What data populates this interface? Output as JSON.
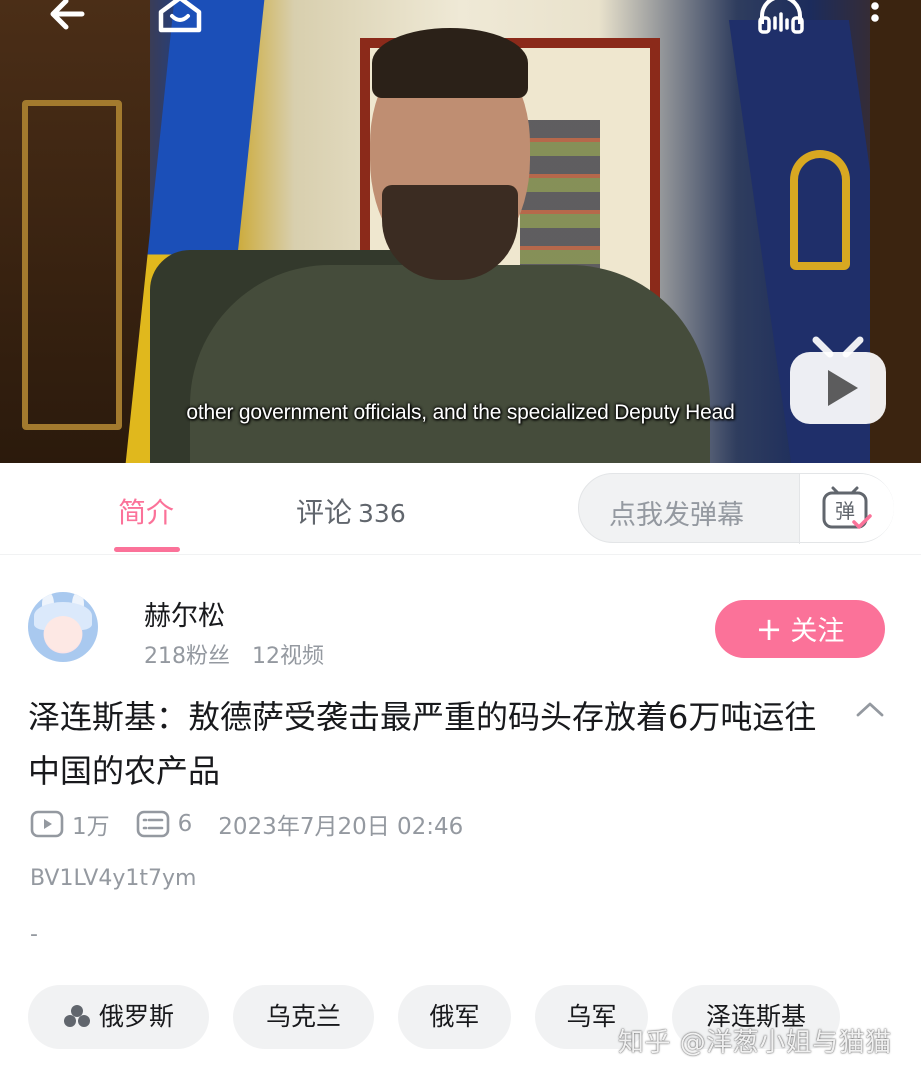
{
  "video": {
    "subtitle": "other government officials, and the specialized Deputy Head"
  },
  "top_bar": {
    "icons": [
      "back-icon",
      "home-icon",
      "audio-icon",
      "more-icon"
    ]
  },
  "tabs": {
    "intro_label": "简介",
    "comments_label": "评论",
    "comments_count": "336",
    "active_color": "#fb7299"
  },
  "danmaku": {
    "placeholder": "点我发弹幕",
    "button_glyph": "弹"
  },
  "uploader": {
    "name": "赫尔松",
    "fans": "218粉丝",
    "videos": "12视频",
    "follow_label": "关注",
    "follow_plus": "+"
  },
  "video_info": {
    "title": "泽连斯基：敖德萨受袭击最严重的码头存放着6万吨运往中国的农产品",
    "views": "1万",
    "danmaku_count": "6",
    "publish_time": "2023年7月20日 02:46",
    "bvid": "BV1LV4y1t7ym",
    "description": "-"
  },
  "tags": [
    "俄罗斯",
    "乌克兰",
    "俄军",
    "乌军",
    "泽连斯基"
  ],
  "watermark": "知乎 @洋葱小姐与猫猫",
  "colors": {
    "brand_pink": "#fb7299",
    "text_primary": "#18191c",
    "text_secondary": "#9499a0"
  }
}
